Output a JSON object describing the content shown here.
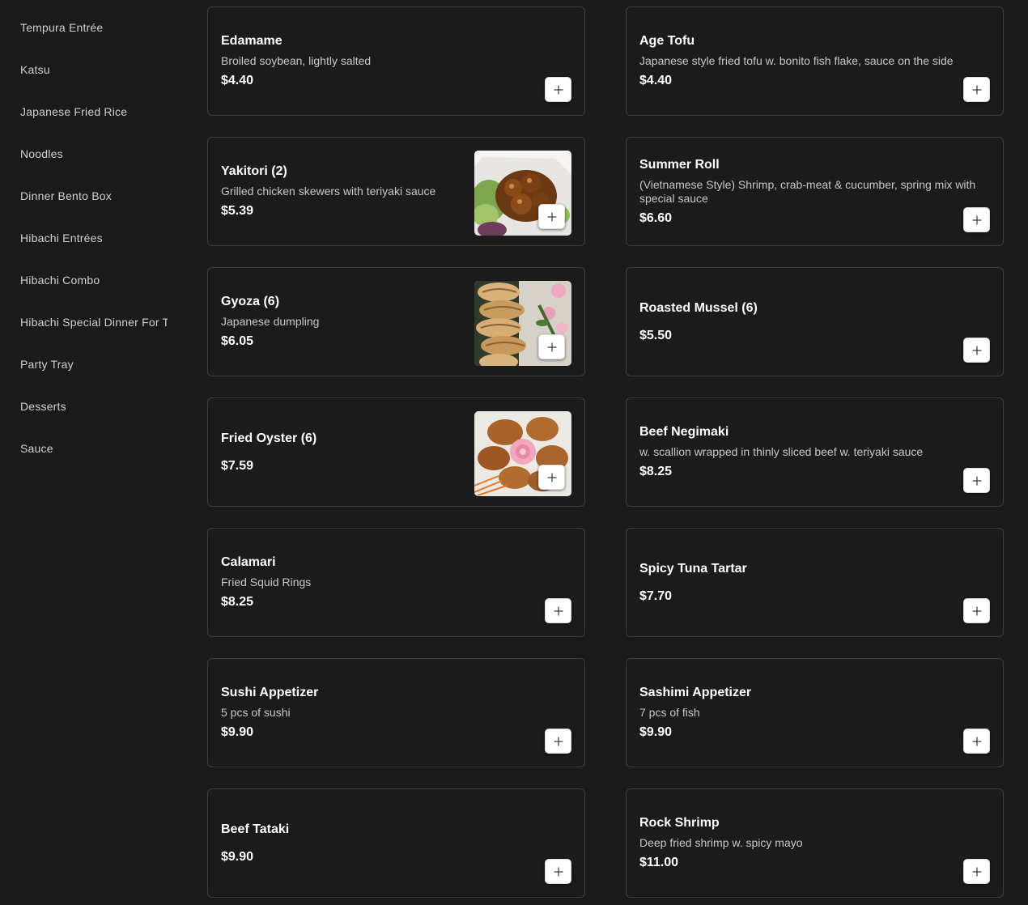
{
  "sidebar": {
    "items": [
      {
        "label": "Tempura Entrée"
      },
      {
        "label": "Katsu"
      },
      {
        "label": "Japanese Fried Rice"
      },
      {
        "label": "Noodles"
      },
      {
        "label": "Dinner Bento Box"
      },
      {
        "label": "Hibachi Entrées"
      },
      {
        "label": "Hibachi Combo"
      },
      {
        "label": "Hibachi Special Dinner For Two"
      },
      {
        "label": "Party Tray"
      },
      {
        "label": "Desserts"
      },
      {
        "label": "Sauce"
      }
    ]
  },
  "menu": {
    "items": [
      {
        "title": "Edamame",
        "description": "Broiled soybean, lightly salted",
        "price": "$4.40"
      },
      {
        "title": "Age Tofu",
        "description": "Japanese style fried tofu w. bonito fish flake, sauce on the side",
        "price": "$4.40"
      },
      {
        "title": "Yakitori (2)",
        "description": "Grilled chicken skewers with teriyaki sauce",
        "price": "$5.39"
      },
      {
        "title": "Summer Roll",
        "description": "(Vietnamese Style) Shrimp, crab-meat & cucumber, spring mix with special sauce",
        "price": "$6.60"
      },
      {
        "title": "Gyoza (6)",
        "description": "Japanese dumpling",
        "price": "$6.05"
      },
      {
        "title": "Roasted Mussel (6)",
        "description": "",
        "price": "$5.50"
      },
      {
        "title": "Fried Oyster (6)",
        "description": "",
        "price": "$7.59"
      },
      {
        "title": "Beef Negimaki",
        "description": "w. scallion wrapped in thinly sliced beef w. teriyaki sauce",
        "price": "$8.25"
      },
      {
        "title": "Calamari",
        "description": "Fried Squid Rings",
        "price": "$8.25"
      },
      {
        "title": "Spicy Tuna Tartar",
        "description": "",
        "price": "$7.70"
      },
      {
        "title": "Sushi Appetizer",
        "description": "5 pcs of sushi",
        "price": "$9.90"
      },
      {
        "title": "Sashimi Appetizer",
        "description": "7 pcs of fish",
        "price": "$9.90"
      },
      {
        "title": "Beef Tataki",
        "description": "",
        "price": "$9.90"
      },
      {
        "title": "Rock Shrimp",
        "description": "Deep fried shrimp w. spicy mayo",
        "price": "$11.00"
      }
    ]
  },
  "icons": {
    "add": "plus-icon"
  }
}
